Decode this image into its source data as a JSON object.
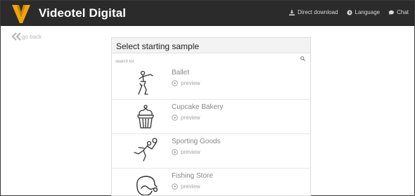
{
  "app": {
    "title": "Videotel Digital"
  },
  "topnav": {
    "direct_download": "Direct download",
    "language": "Language",
    "chat": "Chat"
  },
  "go_back": {
    "label": "go back"
  },
  "panel": {
    "title": "Select starting sample",
    "search_placeholder": "search for",
    "samples": [
      {
        "name": "Ballet",
        "preview": "preview",
        "icon": "ballet-dancer-icon"
      },
      {
        "name": "Cupcake Bakery",
        "preview": "preview",
        "icon": "cupcake-icon"
      },
      {
        "name": "Sporting Goods",
        "preview": "preview",
        "icon": "tennis-player-icon"
      },
      {
        "name": "Fishing Store",
        "preview": "preview",
        "icon": "fish-hook-icon"
      }
    ]
  },
  "colors": {
    "topbar_bg": "#2b2b2b",
    "logo_orange": "#f0a30a",
    "panel_header_bg": "#f3f3f3"
  }
}
